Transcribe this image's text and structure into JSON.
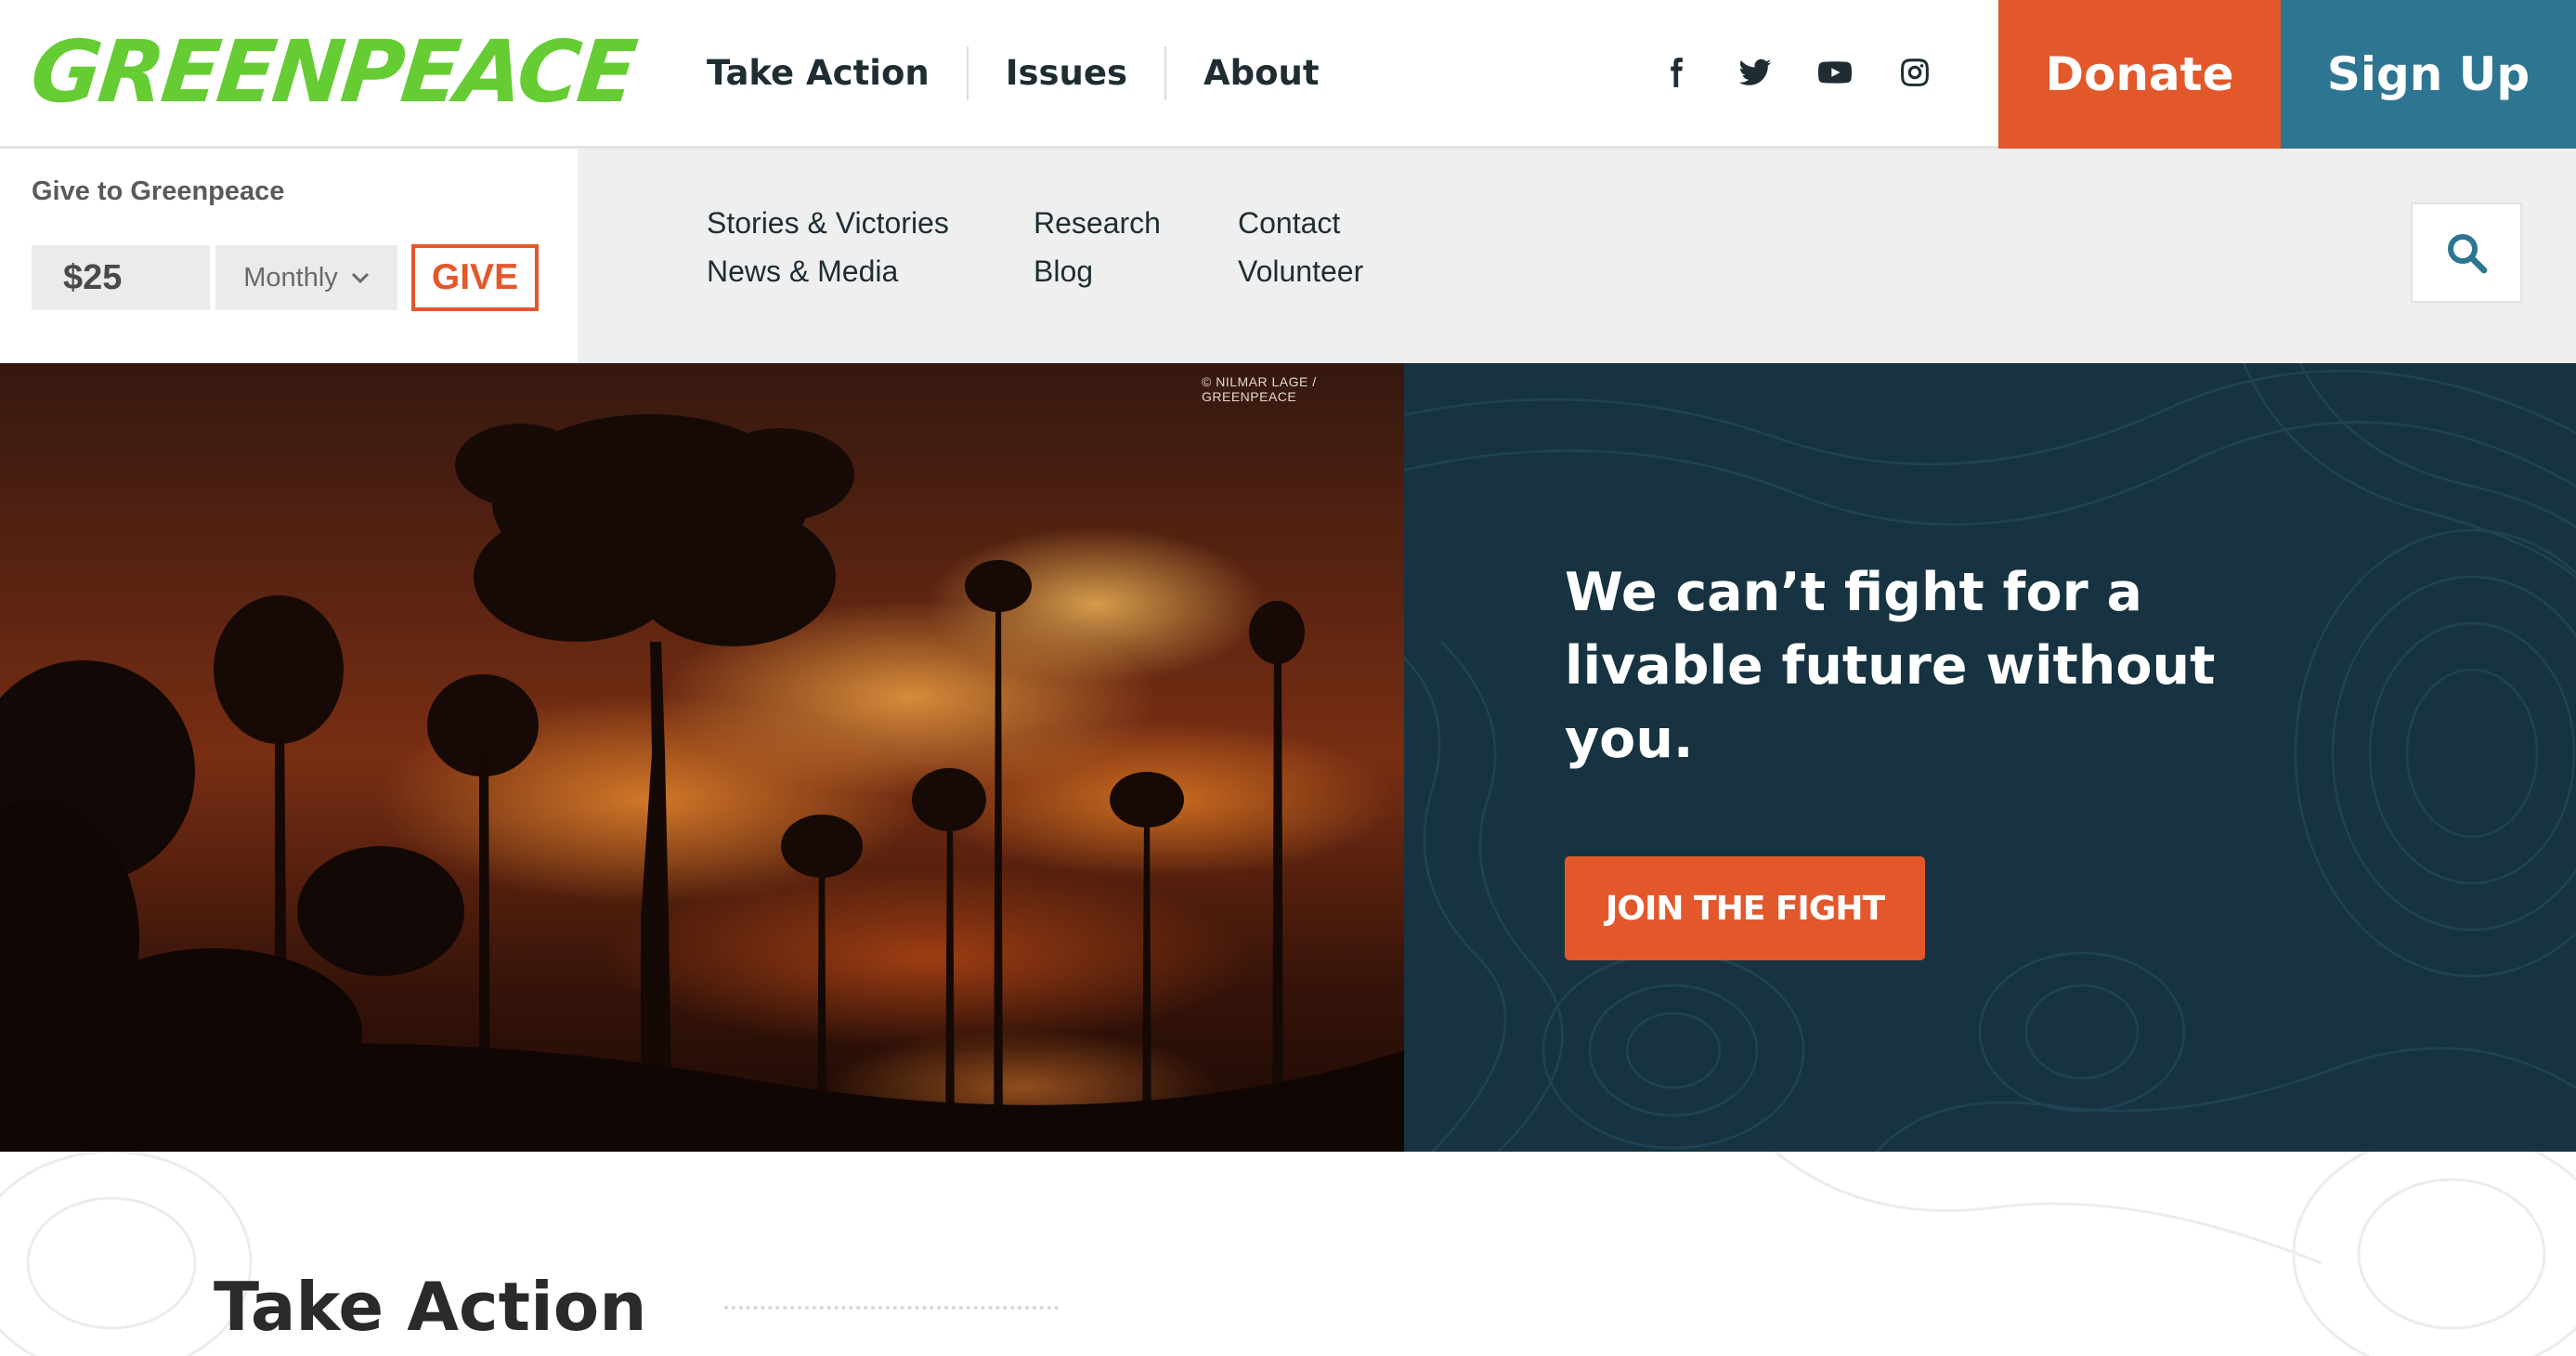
{
  "header": {
    "logo_text": "GREENPEACE",
    "nav": [
      {
        "label": "Take Action"
      },
      {
        "label": "Issues"
      },
      {
        "label": "About"
      }
    ],
    "social_icons": [
      "facebook-icon",
      "twitter-icon",
      "youtube-icon",
      "instagram-icon"
    ],
    "donate_label": "Donate",
    "signup_label": "Sign Up",
    "colors": {
      "logo": "#66cc33",
      "donate": "#e2582a",
      "signup": "#2e7591"
    }
  },
  "give": {
    "title": "Give to Greenpeace",
    "amount": "$25",
    "frequency": "Monthly",
    "button_label": "GIVE"
  },
  "subnav": {
    "links": [
      "Stories & Victories",
      "Research",
      "Contact",
      "News & Media",
      "Blog",
      "Volunteer"
    ],
    "search_icon": "search-icon"
  },
  "hero": {
    "photo_credit": "© NILMAR LAGE / GREENPEACE",
    "headline": "We can’t fight for a livable future without you.",
    "cta_label": "JOIN THE FIGHT",
    "colors": {
      "panel": "#173341",
      "cta": "#e2582a"
    }
  },
  "section": {
    "title": "Take Action"
  }
}
